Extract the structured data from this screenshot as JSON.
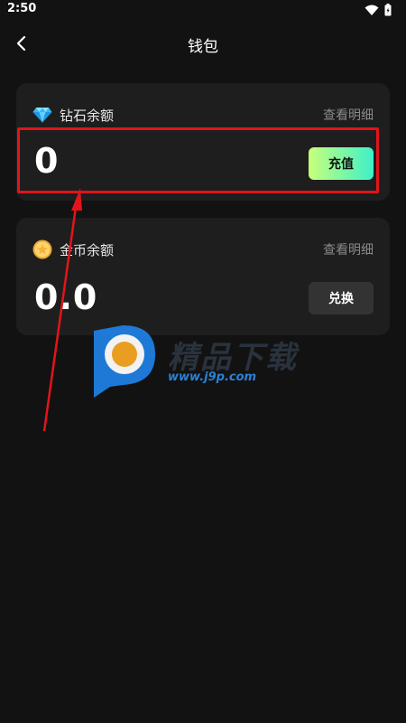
{
  "status_bar": {
    "time": "2:50",
    "icons": [
      "wifi-icon",
      "battery-icon"
    ]
  },
  "header": {
    "title": "钱包",
    "back_icon": "chevron-left-icon"
  },
  "diamond_card": {
    "icon": "diamond-icon",
    "label": "钻石余额",
    "detail_link": "查看明细",
    "balance": "0",
    "action_label": "充值"
  },
  "coin_card": {
    "icon": "coin-icon",
    "label": "金币余额",
    "detail_link": "查看明细",
    "balance": "0.0",
    "action_label": "兑换"
  },
  "annotation": {
    "highlight_color": "#e3141b"
  },
  "watermark": {
    "title": "精品下载",
    "url": "www.j9p.com"
  },
  "colors": {
    "background": "#121212",
    "card": "#1e1e1e",
    "recharge_gradient": [
      "#c8ff7a",
      "#3ef0c8"
    ],
    "exchange_button": "#333333",
    "muted_text": "#8a8a8a"
  }
}
